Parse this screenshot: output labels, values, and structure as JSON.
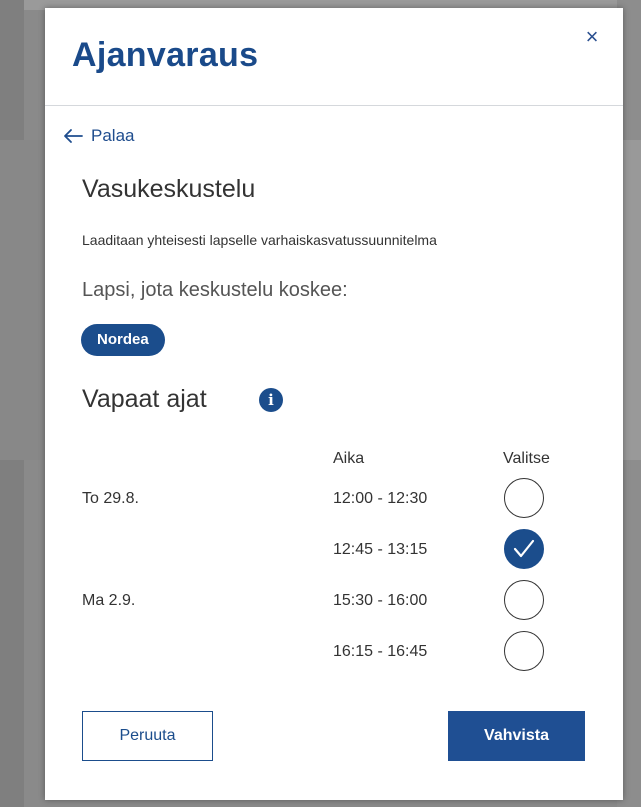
{
  "modal": {
    "title": "Ajanvaraus",
    "close_icon": "×",
    "back_label": "Palaa",
    "meeting_title": "Vasukeskustelu",
    "description": "Laaditaan yhteisesti lapselle varhaiskasvatussuunnitelma",
    "child_label": "Lapsi, jota keskustelu koskee:",
    "child_chip": "Nordea",
    "slots_title": "Vapaat ajat",
    "info_icon": "i",
    "columns": {
      "time": "Aika",
      "select": "Valitse"
    },
    "slots": [
      {
        "day": "To 29.8.",
        "time": "12:00 - 12:30",
        "selected": false
      },
      {
        "day": "",
        "time": "12:45 - 13:15",
        "selected": true
      },
      {
        "day": "Ma 2.9.",
        "time": "15:30 - 16:00",
        "selected": false
      },
      {
        "day": "",
        "time": "16:15 - 16:45",
        "selected": false
      }
    ],
    "cancel_label": "Peruuta",
    "confirm_label": "Vahvista"
  },
  "colors": {
    "brand": "#1b4d8c",
    "title": "#1a4a8a"
  }
}
